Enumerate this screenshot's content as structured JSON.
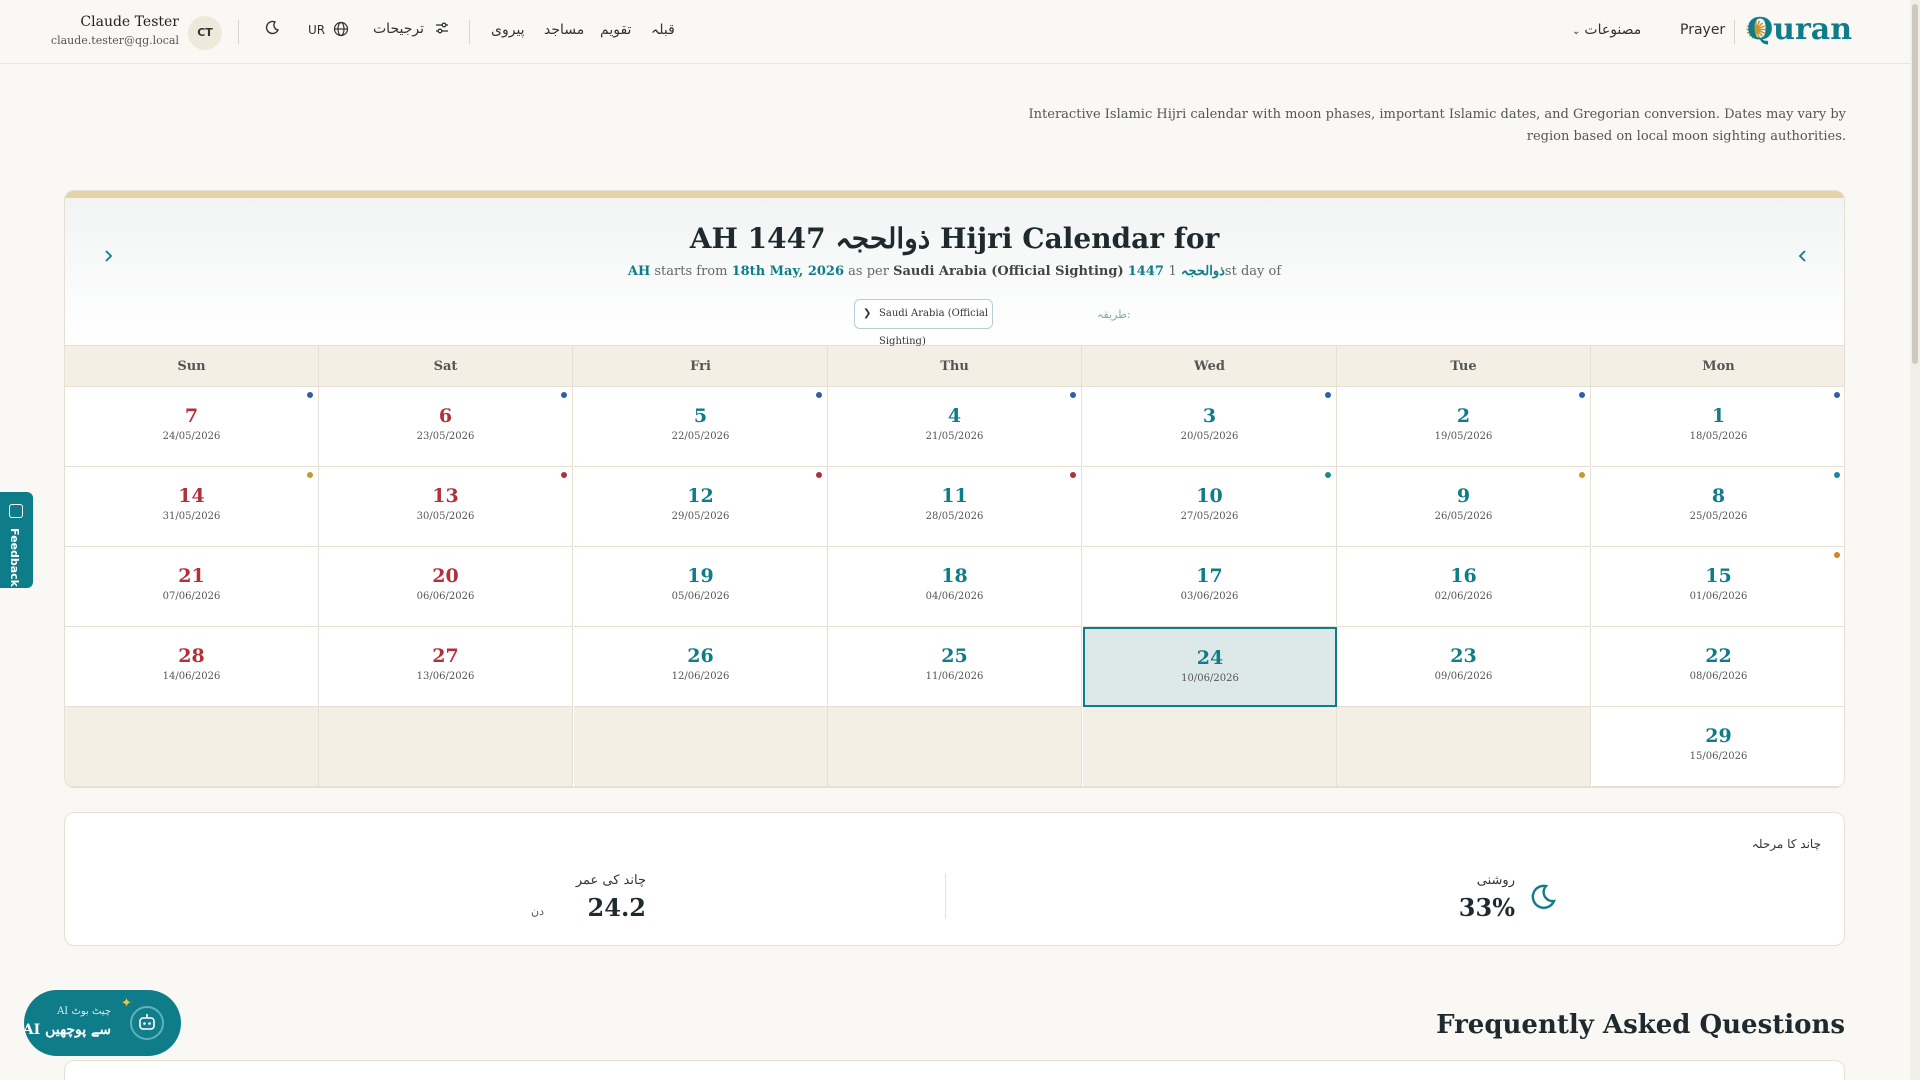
{
  "header": {
    "logo": "Quran",
    "nav_prayer": "Prayer",
    "nav_products": "مصنوعات",
    "nav_qibla": "قبلہ",
    "nav_calendar": "تقویم",
    "nav_mosques": "مساجد",
    "nav_follow": "پیروی",
    "preferences": "ترجیحات",
    "language": "UR",
    "user_name": "Claude Tester",
    "user_email": "claude.tester@qg.local",
    "user_initials": "CT"
  },
  "description": "Interactive Islamic Hijri calendar with moon phases, important Islamic dates, and Gregorian conversion. Dates may vary by region based on local moon sighting authorities.",
  "calendar": {
    "title": "AH 1447 ذوالحجہ Hijri Calendar for",
    "subtitle_ah": "AH",
    "subtitle_starts_from": "starts from",
    "subtitle_date": "18th May, 2026",
    "subtitle_as_per": "as per",
    "subtitle_authority": "Saudi Arabia (Official Sighting)",
    "subtitle_month": "1447 ذوالحجہ",
    "subtitle_first_day": "1st day of",
    "method_label": "طریقہ:",
    "method_value": "Saudi Arabia (Official Sighting)",
    "weekdays": [
      "Mon",
      "Tue",
      "Wed",
      "Thu",
      "Fri",
      "Sat",
      "Sun"
    ],
    "weeks": [
      [
        {
          "d": "1",
          "g": "18/05/2026",
          "dot": "#2e5fa8"
        },
        {
          "d": "2",
          "g": "19/05/2026",
          "dot": "#2e5fa8"
        },
        {
          "d": "3",
          "g": "20/05/2026",
          "dot": "#2e5fa8"
        },
        {
          "d": "4",
          "g": "21/05/2026",
          "dot": "#2e5fa8"
        },
        {
          "d": "5",
          "g": "22/05/2026",
          "dot": "#2e5fa8"
        },
        {
          "d": "6",
          "g": "23/05/2026",
          "dot": "#2e5fa8"
        },
        {
          "d": "7",
          "g": "24/05/2026",
          "dot": "#2e5fa8"
        }
      ],
      [
        {
          "d": "8",
          "g": "25/05/2026",
          "dot": "#1a86a6"
        },
        {
          "d": "9",
          "g": "26/05/2026",
          "dot": "#c8962f"
        },
        {
          "d": "10",
          "g": "27/05/2026",
          "dot": "#1a8a8a"
        },
        {
          "d": "11",
          "g": "28/05/2026",
          "dot": "#a8343a"
        },
        {
          "d": "12",
          "g": "29/05/2026",
          "dot": "#a8343a"
        },
        {
          "d": "13",
          "g": "30/05/2026",
          "dot": "#a8343a"
        },
        {
          "d": "14",
          "g": "31/05/2026",
          "dot": "#c8962f"
        }
      ],
      [
        {
          "d": "15",
          "g": "01/06/2026",
          "dot": "#d0862a"
        },
        {
          "d": "16",
          "g": "02/06/2026"
        },
        {
          "d": "17",
          "g": "03/06/2026"
        },
        {
          "d": "18",
          "g": "04/06/2026"
        },
        {
          "d": "19",
          "g": "05/06/2026"
        },
        {
          "d": "20",
          "g": "06/06/2026"
        },
        {
          "d": "21",
          "g": "07/06/2026"
        }
      ],
      [
        {
          "d": "22",
          "g": "08/06/2026"
        },
        {
          "d": "23",
          "g": "09/06/2026"
        },
        {
          "d": "24",
          "g": "10/06/2026",
          "today": true
        },
        {
          "d": "25",
          "g": "11/06/2026"
        },
        {
          "d": "26",
          "g": "12/06/2026"
        },
        {
          "d": "27",
          "g": "13/06/2026"
        },
        {
          "d": "28",
          "g": "14/06/2026"
        }
      ],
      [
        {
          "d": "29",
          "g": "15/06/2026"
        },
        null,
        null,
        null,
        null,
        null,
        null
      ]
    ]
  },
  "moon": {
    "title": "چاند کا مرحلہ",
    "illumination_label": "روشنی",
    "illumination_value": "33%",
    "age_label": "چاند کی عمر",
    "age_value": "24.2",
    "age_unit": "دن"
  },
  "faq": {
    "title": "Frequently Asked Questions"
  },
  "feedback": {
    "label": "Feedback"
  },
  "ai": {
    "line1": "AI چیٹ بوٹ",
    "line2": "AI سے پوچھیں"
  }
}
